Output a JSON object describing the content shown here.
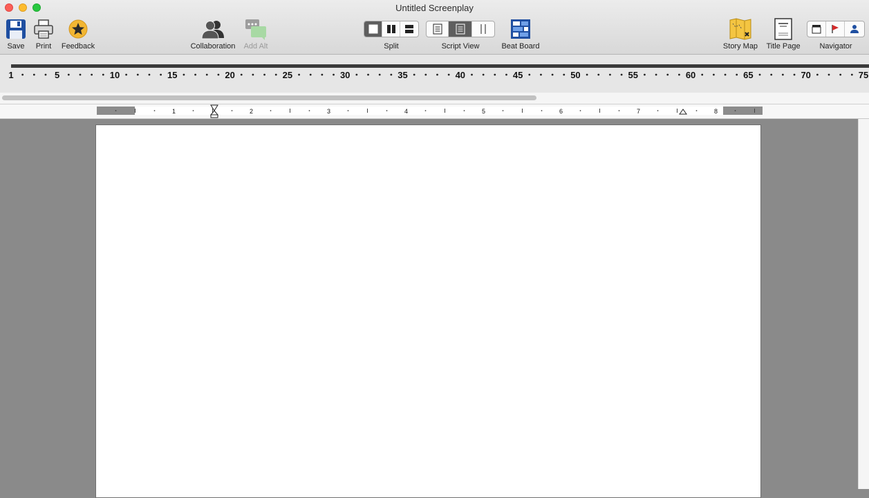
{
  "window": {
    "title": "Untitled Screenplay"
  },
  "toolbar": {
    "save": "Save",
    "print": "Print",
    "feedback": "Feedback",
    "collaboration": "Collaboration",
    "add_alt": "Add Alt",
    "split": "Split",
    "script_view": "Script View",
    "beat_board": "Beat Board",
    "story_map": "Story Map",
    "title_page": "Title Page",
    "navigator": "Navigator"
  },
  "column_ruler": {
    "labels": [
      "1",
      "5",
      "10",
      "15",
      "20",
      "25",
      "30",
      "35",
      "40",
      "45",
      "50",
      "55",
      "60",
      "65",
      "70",
      "75"
    ]
  },
  "page_ruler": {
    "labels": [
      "1",
      "2",
      "3",
      "4",
      "5",
      "6",
      "7",
      "8"
    ]
  },
  "colors": {
    "accent_blue": "#1f4fa1",
    "feedback_gold": "#f2b632",
    "navigator_flag": "#d42a2a"
  }
}
